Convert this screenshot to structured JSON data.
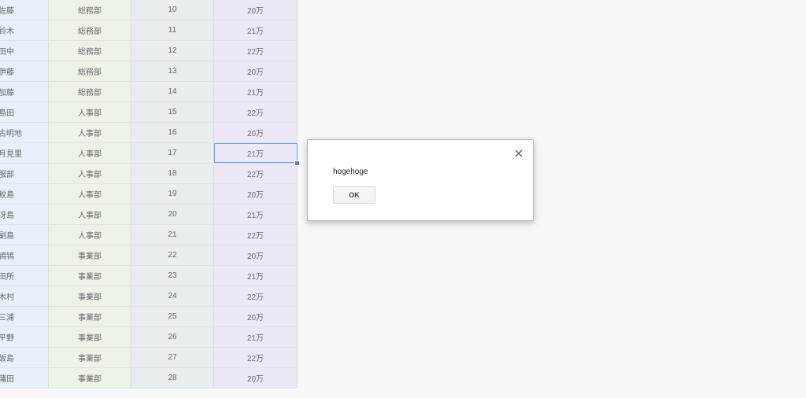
{
  "sheet": {
    "rows": [
      {
        "name": "佐藤",
        "dept": "総務部",
        "num": "10",
        "salary": "20万"
      },
      {
        "name": "鈴木",
        "dept": "総務部",
        "num": "11",
        "salary": "21万"
      },
      {
        "name": "田中",
        "dept": "総務部",
        "num": "12",
        "salary": "22万"
      },
      {
        "name": "伊藤",
        "dept": "総務部",
        "num": "13",
        "salary": "20万"
      },
      {
        "name": "加藤",
        "dept": "総務部",
        "num": "14",
        "salary": "21万"
      },
      {
        "name": "島田",
        "dept": "人事部",
        "num": "15",
        "salary": "22万"
      },
      {
        "name": "古明地",
        "dept": "人事部",
        "num": "16",
        "salary": "20万"
      },
      {
        "name": "月見里",
        "dept": "人事部",
        "num": "17",
        "salary": "21万"
      },
      {
        "name": "服部",
        "dept": "人事部",
        "num": "18",
        "salary": "22万"
      },
      {
        "name": "鮫島",
        "dept": "人事部",
        "num": "19",
        "salary": "20万"
      },
      {
        "name": "冴島",
        "dept": "人事部",
        "num": "20",
        "salary": "21万"
      },
      {
        "name": "副島",
        "dept": "人事部",
        "num": "21",
        "salary": "22万"
      },
      {
        "name": "鴇鴇",
        "dept": "事業部",
        "num": "22",
        "salary": "20万"
      },
      {
        "name": "田所",
        "dept": "事業部",
        "num": "23",
        "salary": "21万"
      },
      {
        "name": "木村",
        "dept": "事業部",
        "num": "24",
        "salary": "22万"
      },
      {
        "name": "三浦",
        "dept": "事業部",
        "num": "25",
        "salary": "20万"
      },
      {
        "name": "平野",
        "dept": "事業部",
        "num": "26",
        "salary": "21万"
      },
      {
        "name": "飯島",
        "dept": "事業部",
        "num": "27",
        "salary": "22万"
      },
      {
        "name": "蒲田",
        "dept": "事業部",
        "num": "28",
        "salary": "20万"
      }
    ],
    "selected_row": 7,
    "selected_col": "salary"
  },
  "dialog": {
    "message": "hogehoge",
    "ok_label": "OK",
    "close_icon": "close-icon"
  },
  "colors": {
    "selection": "#4a86e8",
    "col_name_bg": "#e8f0fb",
    "col_dept_bg": "#ecf4e8",
    "col_num_bg": "#e9eef0",
    "col_salary_bg": "#ede8f5"
  }
}
